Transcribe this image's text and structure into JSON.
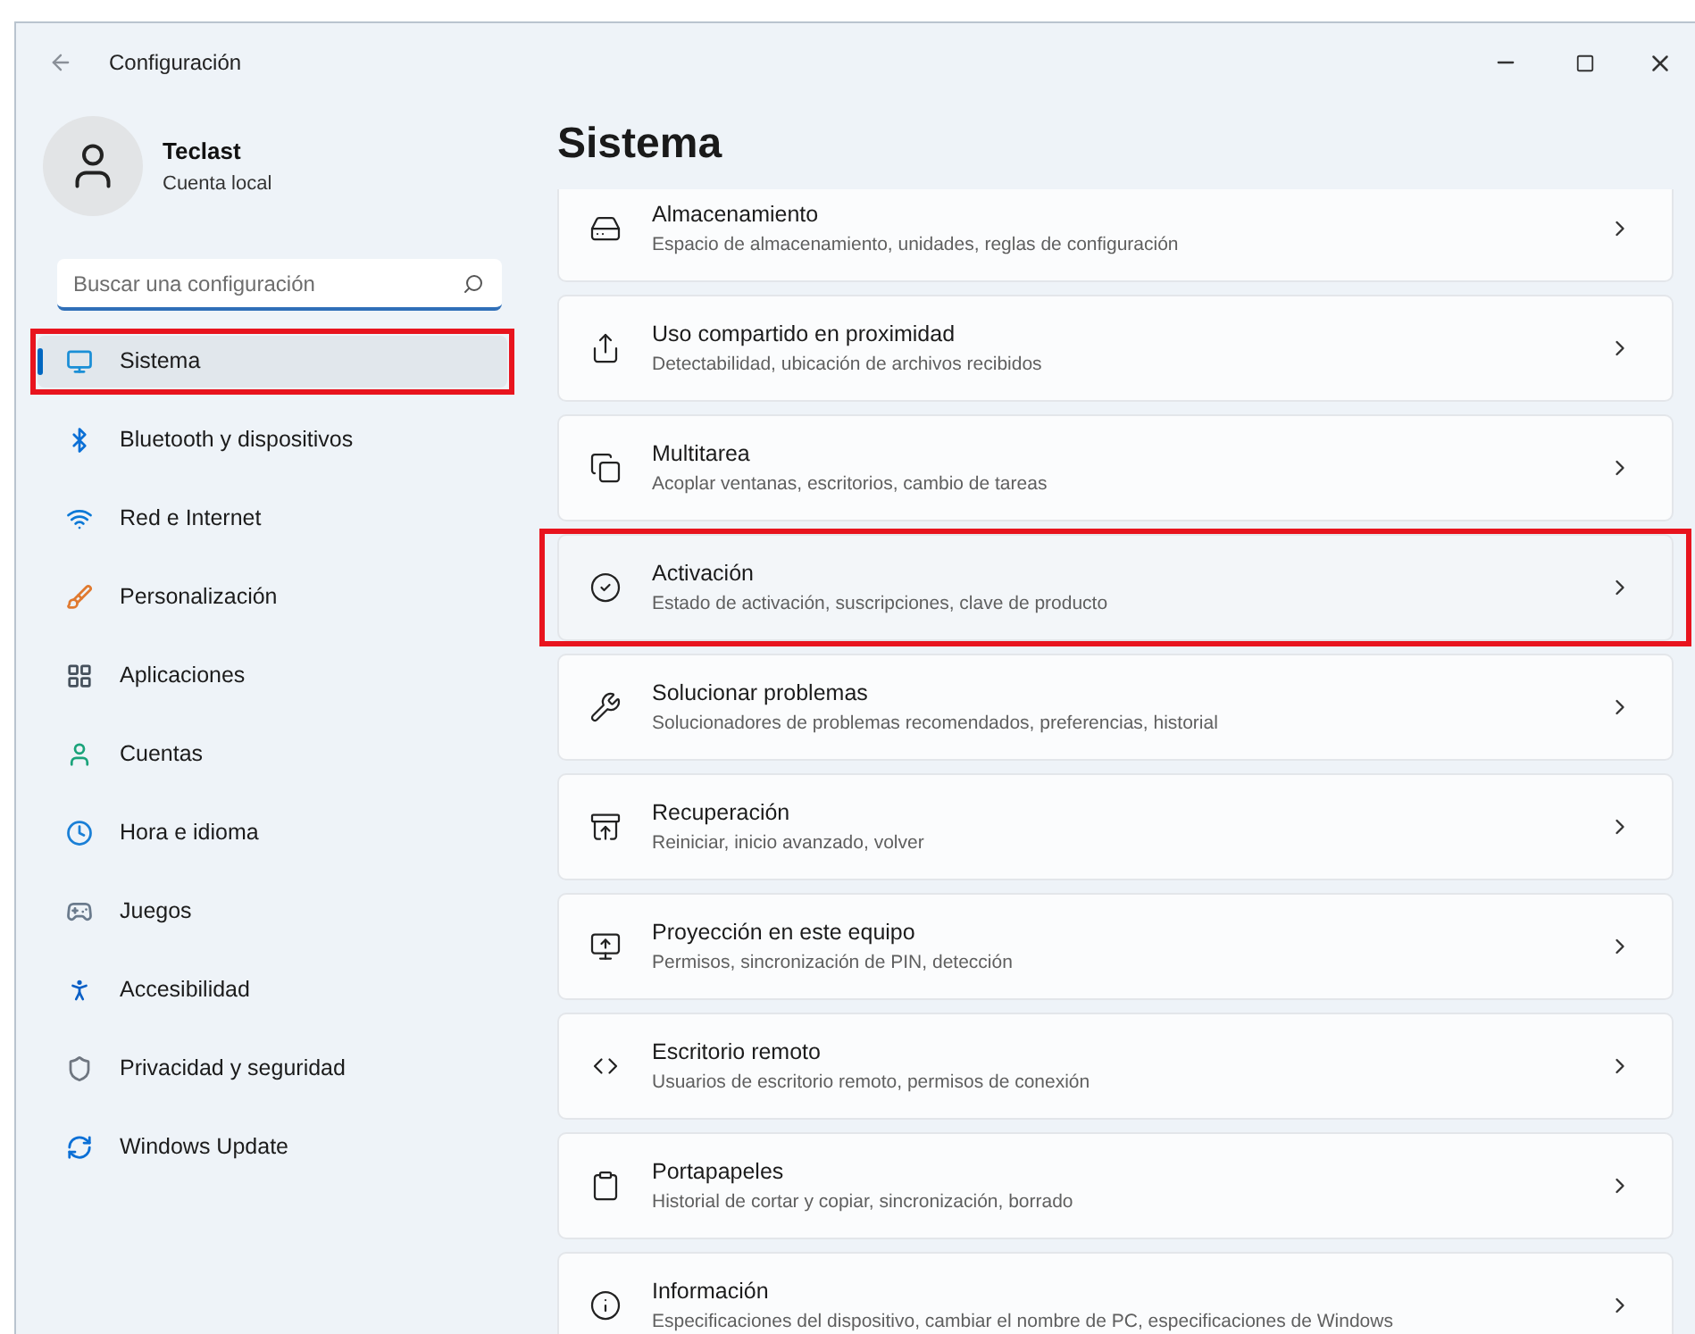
{
  "window": {
    "title": "Configuración"
  },
  "account": {
    "name": "Teclast",
    "type": "Cuenta local"
  },
  "search": {
    "placeholder": "Buscar una configuración"
  },
  "sidebar": {
    "items": [
      {
        "label": "Sistema",
        "selected": true,
        "highlighted": true
      },
      {
        "label": "Bluetooth y dispositivos",
        "selected": false,
        "highlighted": false
      },
      {
        "label": "Red e Internet",
        "selected": false,
        "highlighted": false
      },
      {
        "label": "Personalización",
        "selected": false,
        "highlighted": false
      },
      {
        "label": "Aplicaciones",
        "selected": false,
        "highlighted": false
      },
      {
        "label": "Cuentas",
        "selected": false,
        "highlighted": false
      },
      {
        "label": "Hora e idioma",
        "selected": false,
        "highlighted": false
      },
      {
        "label": "Juegos",
        "selected": false,
        "highlighted": false
      },
      {
        "label": "Accesibilidad",
        "selected": false,
        "highlighted": false
      },
      {
        "label": "Privacidad y seguridad",
        "selected": false,
        "highlighted": false
      },
      {
        "label": "Windows Update",
        "selected": false,
        "highlighted": false
      }
    ]
  },
  "page": {
    "title": "Sistema",
    "items": [
      {
        "title": "Almacenamiento",
        "description": "Espacio de almacenamiento, unidades, reglas de configuración",
        "highlighted": false
      },
      {
        "title": "Uso compartido en proximidad",
        "description": "Detectabilidad, ubicación de archivos recibidos",
        "highlighted": false
      },
      {
        "title": "Multitarea",
        "description": "Acoplar ventanas, escritorios, cambio de tareas",
        "highlighted": false
      },
      {
        "title": "Activación",
        "description": "Estado de activación, suscripciones, clave de producto",
        "highlighted": true
      },
      {
        "title": "Solucionar problemas",
        "description": "Solucionadores de problemas recomendados, preferencias, historial",
        "highlighted": false
      },
      {
        "title": "Recuperación",
        "description": "Reiniciar, inicio avanzado, volver",
        "highlighted": false
      },
      {
        "title": "Proyección en este equipo",
        "description": "Permisos, sincronización de PIN, detección",
        "highlighted": false
      },
      {
        "title": "Escritorio remoto",
        "description": "Usuarios de escritorio remoto, permisos de conexión",
        "highlighted": false
      },
      {
        "title": "Portapapeles",
        "description": "Historial de cortar y copiar, sincronización, borrado",
        "highlighted": false
      },
      {
        "title": "Información",
        "description": "Especificaciones del dispositivo, cambiar el nombre de PC, especificaciones de Windows",
        "highlighted": false
      }
    ]
  }
}
